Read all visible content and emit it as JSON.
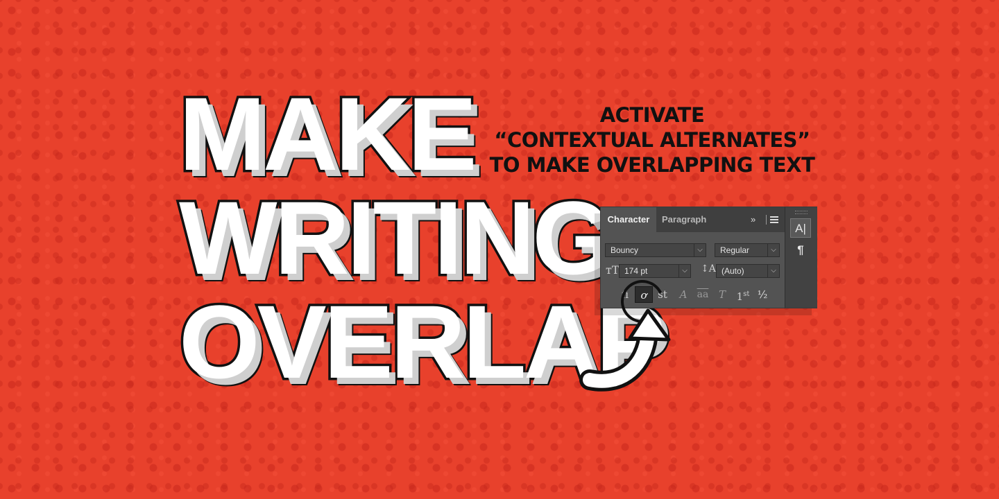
{
  "headline": {
    "line1": "MAKE",
    "line2": "WRITING",
    "line3": "OVERLAP"
  },
  "note": {
    "line1": "ACTIVATE",
    "line2": "“CONTEXTUAL ALTERNATES”",
    "line3": "TO MAKE OVERLAPPING TEXT"
  },
  "panel": {
    "tabs": [
      "Character",
      "Paragraph"
    ],
    "expand_icon": "»",
    "font_family": "Bouncy",
    "font_style": "Regular",
    "font_size": "174 pt",
    "leading": "(Auto)",
    "size_icon_glyph": "ᴛT",
    "leading_icon_glyph": "↕A",
    "glyphs": {
      "ligatures": "fi",
      "contextual_alternates": "ơ",
      "discretionary_ligatures": "st",
      "swash": "A",
      "titling": "T",
      "ordinals_base": "a",
      "ordinals": "aa",
      "superscript_base": "1",
      "superscript_sup": "st",
      "fractions": "½"
    },
    "side_buttons": [
      "A|",
      "¶"
    ],
    "chevron": "⌵"
  },
  "icons": {
    "arrow": "curved-arrow-icon",
    "highlight": "circle-highlight"
  },
  "colors": {
    "background": "#e8412c",
    "panel": "#535353",
    "text_dark": "#111111",
    "text_light": "#ffffff"
  }
}
